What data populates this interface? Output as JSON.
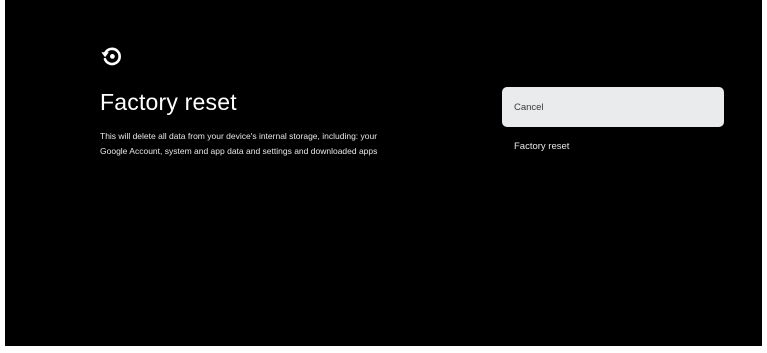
{
  "page": {
    "title": "Factory reset",
    "description": "This will delete all data from your device's internal storage, including: your Google Account, system and app data and settings and downloaded apps",
    "icon": "restore-icon",
    "background_color": "#000000",
    "focus_color": "#e9ebed"
  },
  "options": [
    {
      "label": "Cancel",
      "focused": true
    },
    {
      "label": "Factory reset",
      "focused": false
    }
  ]
}
